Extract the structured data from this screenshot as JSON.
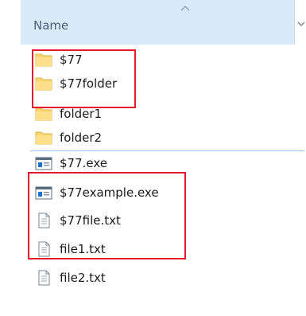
{
  "header": {
    "column_name": "Name"
  },
  "files": [
    {
      "name": "$77",
      "icon": "folder-icon"
    },
    {
      "name": "$77folder",
      "icon": "folder-icon"
    },
    {
      "name": "folder1",
      "icon": "folder-icon"
    },
    {
      "name": "folder2",
      "icon": "folder-icon"
    },
    {
      "name": "$77.exe",
      "icon": "exe-icon"
    },
    {
      "name": "$77example.exe",
      "icon": "exe-icon"
    },
    {
      "name": "$77file.txt",
      "icon": "text-file-icon"
    },
    {
      "name": "file1.txt",
      "icon": "text-file-icon"
    },
    {
      "name": "file2.txt",
      "icon": "text-file-icon"
    }
  ],
  "colors": {
    "highlight_border": "#e41b2b",
    "header_background": "#d9ebf9",
    "folder_yellow": "#f7d570",
    "selection_line": "#9fc4e4"
  }
}
